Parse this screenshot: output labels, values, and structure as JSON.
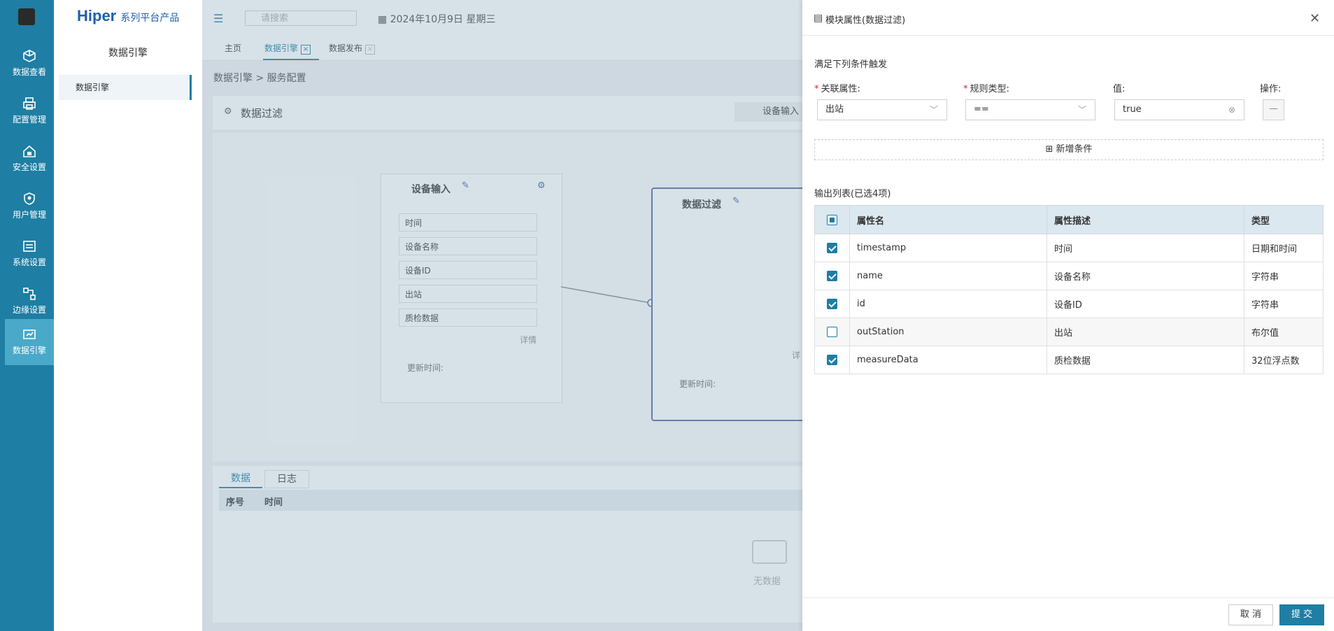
{
  "app": {
    "brand": "Hiper",
    "brand_suffix": "系列平台产品"
  },
  "rail": {
    "items": [
      {
        "label": "数据查看",
        "icon": "cube-icon"
      },
      {
        "label": "配置管理",
        "icon": "printer-icon"
      },
      {
        "label": "安全设置",
        "icon": "house-lock-icon"
      },
      {
        "label": "用户管理",
        "icon": "shield-user-icon"
      },
      {
        "label": "系统设置",
        "icon": "settings-list-icon"
      },
      {
        "label": "边缘设置",
        "icon": "nodes-icon"
      },
      {
        "label": "数据引擎",
        "icon": "engine-icon"
      }
    ]
  },
  "sidebar": {
    "title": "数据引擎",
    "items": [
      {
        "label": "数据引擎"
      }
    ]
  },
  "topbar": {
    "search_placeholder": "请搜索",
    "date": "2024年10月9日 星期三"
  },
  "tabs": [
    {
      "label": "主页"
    },
    {
      "label": "数据引擎"
    },
    {
      "label": "数据发布"
    }
  ],
  "breadcrumb": {
    "part1": "数据引擎",
    "sep": ">",
    "part2": "服务配置"
  },
  "panel": {
    "title": "数据过滤",
    "toolbar_item": "设备输入"
  },
  "canvas": {
    "card1": {
      "title": "设备输入",
      "fields": [
        "时间",
        "设备名称",
        "设备ID",
        "出站",
        "质检数据"
      ],
      "details": "详情",
      "update_time": "更新时间:"
    },
    "card2": {
      "title": "数据过滤",
      "details": "详",
      "update_time": "更新时间:"
    }
  },
  "bottom": {
    "tabs": [
      "数据",
      "日志"
    ],
    "columns": [
      "序号",
      "时间"
    ],
    "empty": "无数据"
  },
  "drawer": {
    "title": "模块属性(数据过滤)",
    "section_trigger": "满足下列条件触发",
    "labels": {
      "attr": "关联属性:",
      "rule": "规则类型:",
      "value": "值:",
      "op": "操作:"
    },
    "values": {
      "attr": "出站",
      "rule": "==",
      "value": "true"
    },
    "add_condition": "新增条件",
    "output_title": "输出列表(已选4项)",
    "table_headers": [
      "属性名",
      "属性描述",
      "类型"
    ],
    "rows": [
      {
        "name": "timestamp",
        "desc": "时间",
        "type": "日期和时间",
        "checked": true
      },
      {
        "name": "name",
        "desc": "设备名称",
        "type": "字符串",
        "checked": true
      },
      {
        "name": "id",
        "desc": "设备ID",
        "type": "字符串",
        "checked": true
      },
      {
        "name": "outStation",
        "desc": "出站",
        "type": "布尔值",
        "checked": false
      },
      {
        "name": "measureData",
        "desc": "质检数据",
        "type": "32位浮点数",
        "checked": true
      }
    ],
    "cancel": "取 消",
    "submit": "提 交"
  },
  "colors": {
    "primary": "#1e7ea3",
    "rail": "#1e7ea3",
    "required": "#e02020"
  }
}
